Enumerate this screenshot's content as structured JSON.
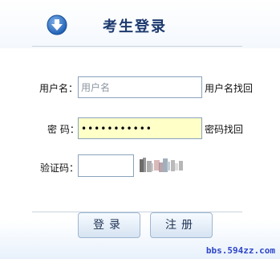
{
  "header": {
    "title": "考生登录",
    "icon": "download-arrow-icon"
  },
  "form": {
    "username_label": "用户名：",
    "username_value": "",
    "username_placeholder": "用户名",
    "username_recover_link": "用户名找回",
    "password_label": "密 码：",
    "password_value": "•••••••••••",
    "password_recover_link": "密码找回",
    "captcha_label": "验证码：",
    "captcha_value": ""
  },
  "buttons": {
    "login": "登录",
    "register": "注册"
  },
  "watermark": "bbs.594zz.com",
  "colors": {
    "accent": "#3a78c8",
    "title": "#1d3a6e",
    "password_bg": "#ffffc8",
    "watermark": "#2d45c8"
  }
}
